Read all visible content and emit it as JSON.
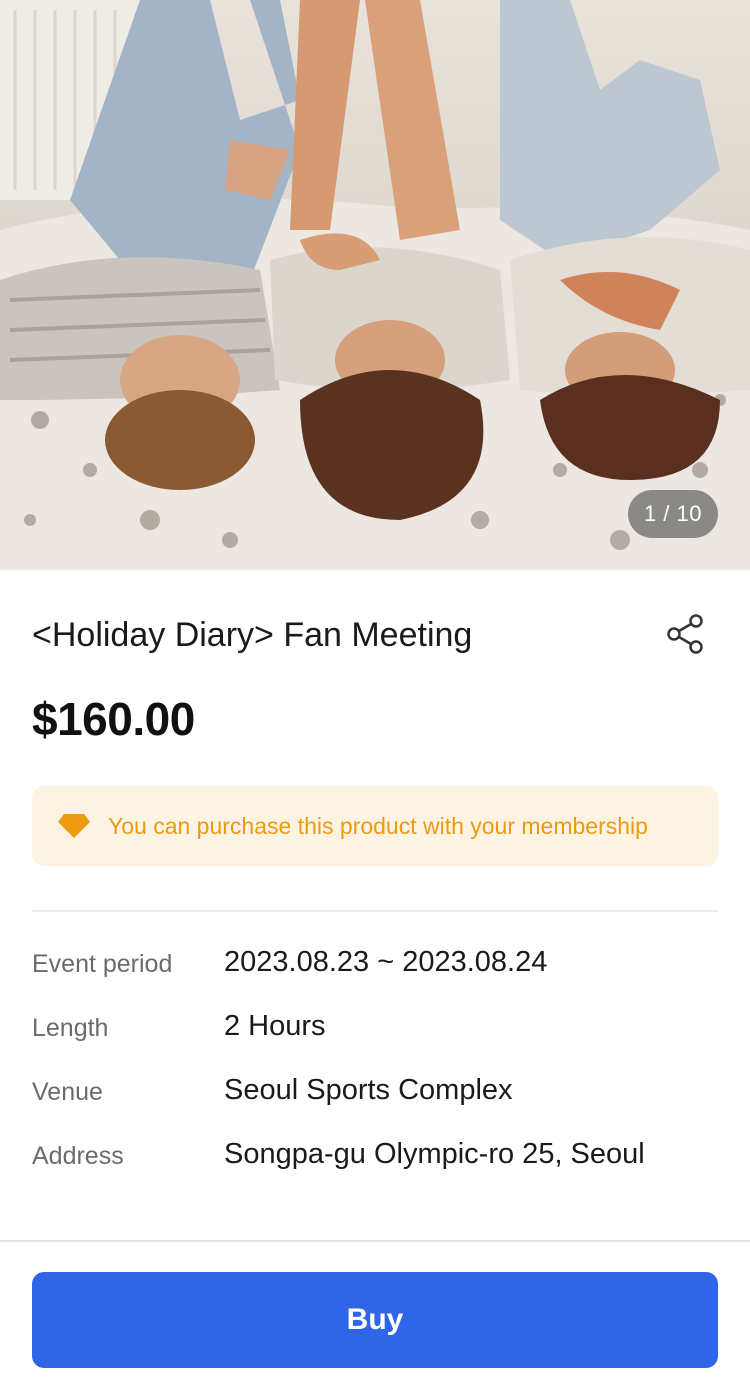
{
  "gallery": {
    "image_alt": "Three people lying upside down on a floral bed",
    "counter": "1 / 10"
  },
  "product": {
    "title": "<Holiday Diary> Fan Meeting",
    "price": "$160.00",
    "share_icon": "share-icon"
  },
  "membership": {
    "icon": "diamond-icon",
    "text": "You can purchase this product with your membership",
    "color": "#ee9a11",
    "background": "#fdf3e3"
  },
  "details": [
    {
      "label": "Event period",
      "value": "2023.08.23 ~ 2023.08.24"
    },
    {
      "label": "Length",
      "value": "2 Hours"
    },
    {
      "label": "Venue",
      "value": "Seoul Sports Complex"
    },
    {
      "label": "Address",
      "value": "Songpa-gu Olympic-ro 25, Seoul"
    }
  ],
  "actions": {
    "buy_label": "Buy",
    "buy_color": "#3165e8"
  }
}
